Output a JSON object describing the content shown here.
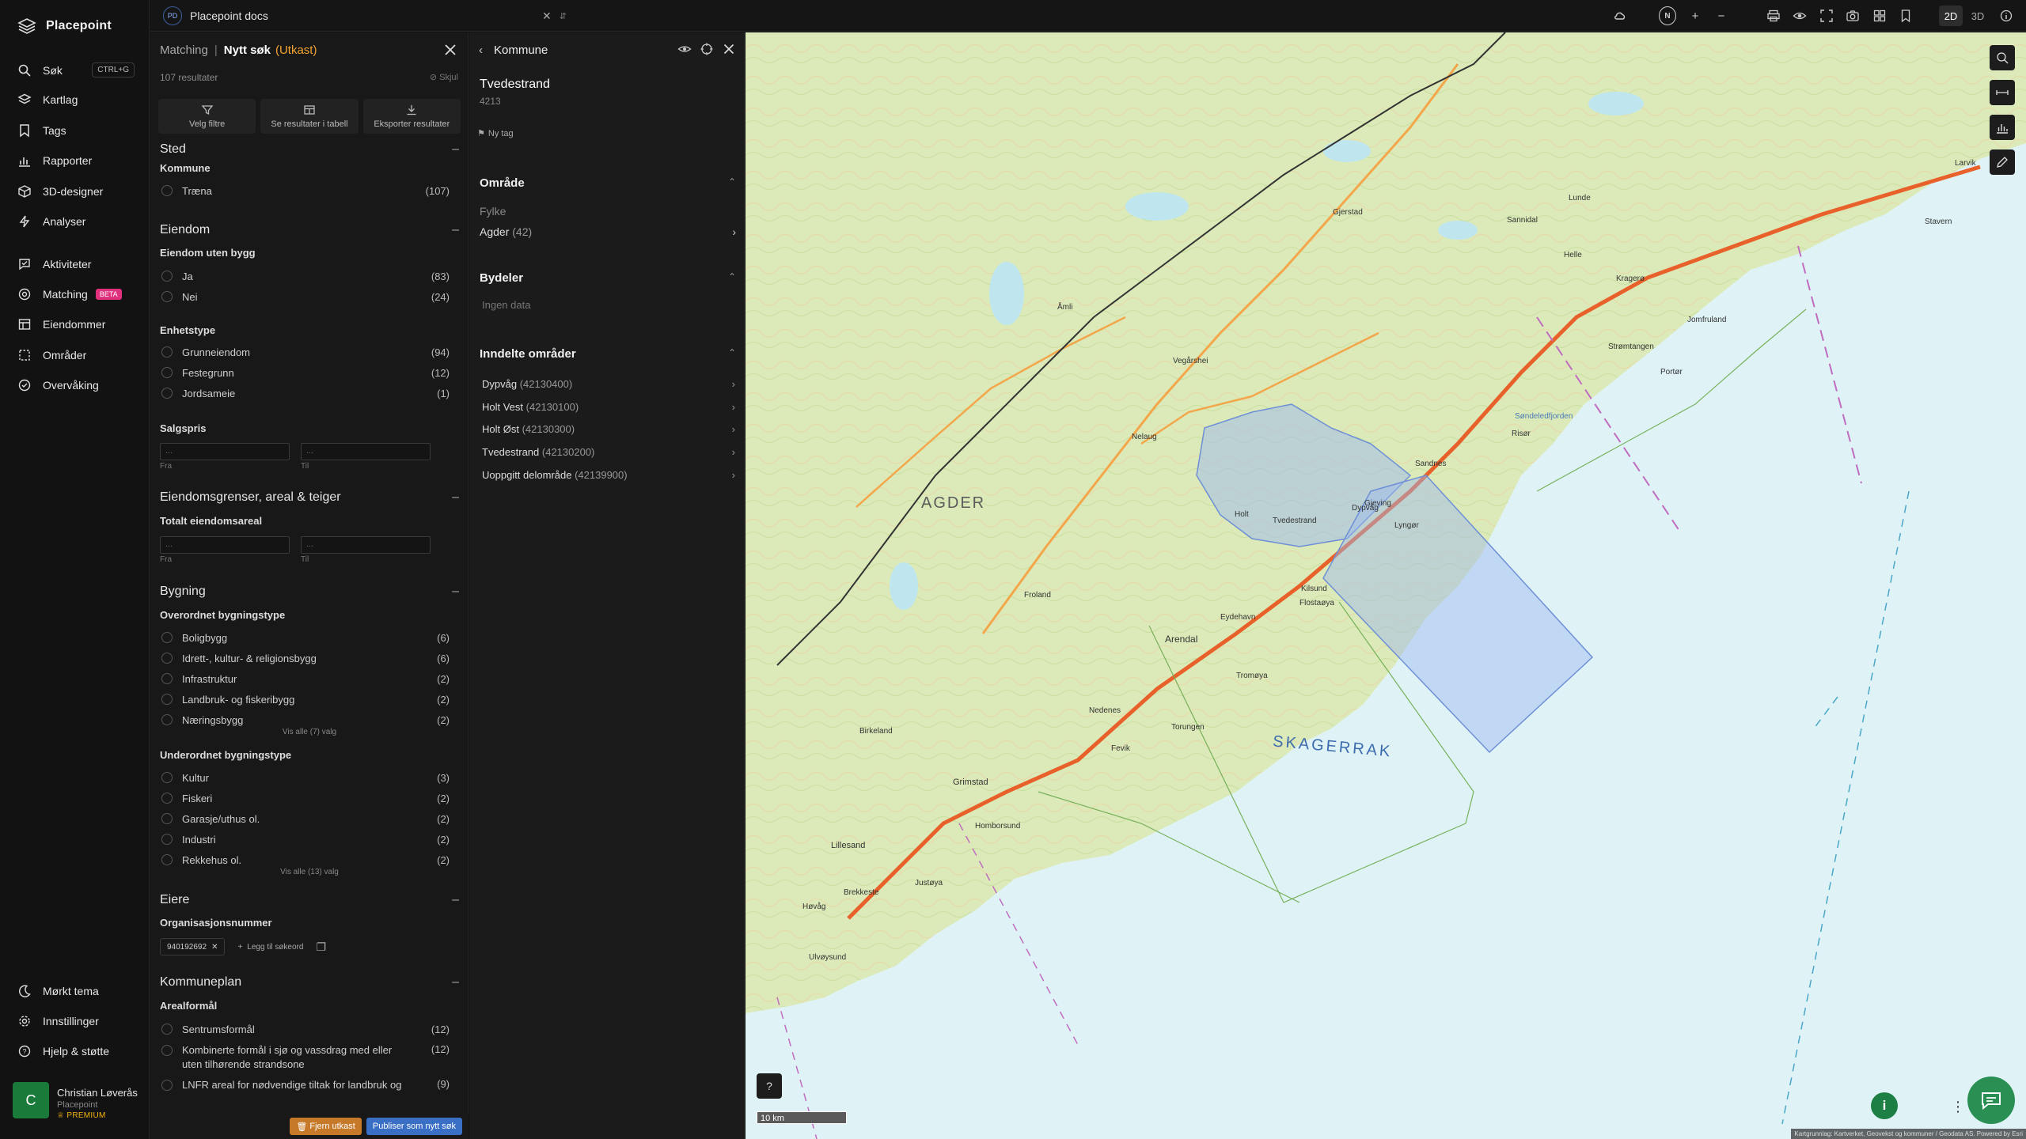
{
  "sidebar": {
    "brand": "Placepoint",
    "nav": [
      {
        "label": "Søk",
        "icon": "search-icon",
        "shortcut": "CTRL+G"
      },
      {
        "label": "Kartlag",
        "icon": "layers-icon"
      },
      {
        "label": "Tags",
        "icon": "bookmark-icon"
      },
      {
        "label": "Rapporter",
        "icon": "chart-icon"
      },
      {
        "label": "3D-designer",
        "icon": "cube-icon"
      },
      {
        "label": "Analyser",
        "icon": "bolt-icon"
      },
      {
        "label": "Aktiviteter",
        "icon": "activity-icon"
      },
      {
        "label": "Matching",
        "icon": "target-icon",
        "badge": "BETA"
      },
      {
        "label": "Eiendommer",
        "icon": "property-icon"
      },
      {
        "label": "Områder",
        "icon": "area-icon"
      },
      {
        "label": "Overvåking",
        "icon": "monitor-icon"
      }
    ],
    "bottom_nav": [
      {
        "label": "Mørkt tema",
        "icon": "moon-icon"
      },
      {
        "label": "Innstillinger",
        "icon": "gear-icon"
      },
      {
        "label": "Hjelp & støtte",
        "icon": "help-icon"
      }
    ],
    "user": {
      "initial": "C",
      "name": "Christian Løverås",
      "org": "Placepoint",
      "plan": "PREMIUM"
    }
  },
  "topbar": {
    "doc_badge": "PD",
    "doc_name": "Placepoint docs",
    "north": "N",
    "dim_2d": "2D",
    "dim_3d": "3D"
  },
  "filter": {
    "crumb": "Matching",
    "separator": "|",
    "title": "Nytt søk",
    "draft": "(Utkast)",
    "results": "107 resultater",
    "hide": "Skjul",
    "actions": [
      "Velg filtre",
      "Se resultater i tabell",
      "Eksporter resultater"
    ],
    "sections": {
      "sted": {
        "title": "Sted",
        "kommune_label": "Kommune",
        "options": [
          {
            "label": "Træna",
            "count": "(107)"
          }
        ]
      },
      "eiendom": {
        "title": "Eiendom",
        "uten_bygg_label": "Eiendom uten bygg",
        "uten_bygg": [
          {
            "label": "Ja",
            "count": "(83)"
          },
          {
            "label": "Nei",
            "count": "(24)"
          }
        ],
        "enhetstype_label": "Enhetstype",
        "enhetstype": [
          {
            "label": "Grunneiendom",
            "count": "(94)"
          },
          {
            "label": "Festegrunn",
            "count": "(12)"
          },
          {
            "label": "Jordsameie",
            "count": "(1)"
          }
        ],
        "salgspris_label": "Salgspris",
        "from_label": "Fra",
        "to_label": "Til",
        "placeholder": "..."
      },
      "grenser": {
        "title": "Eiendomsgrenser, areal & teiger",
        "total_label": "Totalt eiendomsareal"
      },
      "bygning": {
        "title": "Bygning",
        "overordnet_label": "Overordnet bygningstype",
        "overordnet": [
          {
            "label": "Boligbygg",
            "count": "(6)"
          },
          {
            "label": "Idrett-, kultur- & religionsbygg",
            "count": "(6)"
          },
          {
            "label": "Infrastruktur",
            "count": "(2)"
          },
          {
            "label": "Landbruk- og fiskeribygg",
            "count": "(2)"
          },
          {
            "label": "Næringsbygg",
            "count": "(2)"
          }
        ],
        "overordnet_more": "Vis alle (7) valg",
        "underordnet_label": "Underordnet bygningstype",
        "underordnet": [
          {
            "label": "Kultur",
            "count": "(3)"
          },
          {
            "label": "Fiskeri",
            "count": "(2)"
          },
          {
            "label": "Garasje/uthus ol.",
            "count": "(2)"
          },
          {
            "label": "Industri",
            "count": "(2)"
          },
          {
            "label": "Rekkehus ol.",
            "count": "(2)"
          }
        ],
        "underordnet_more": "Vis alle (13) valg"
      },
      "eiere": {
        "title": "Eiere",
        "org_label": "Organisasjonsnummer",
        "chip": "940192692",
        "add": "Legg til søkeord"
      },
      "kommuneplan": {
        "title": "Kommuneplan",
        "areal_label": "Arealformål",
        "options": [
          {
            "label": "Sentrumsformål",
            "count": "(12)"
          },
          {
            "label": "Kombinerte formål i sjø og vassdrag med eller uten tilhørende strandsone",
            "count": "(12)"
          },
          {
            "label": "LNFR areal for nødvendige tiltak for landbruk og reindrift og",
            "count": "(9)"
          }
        ]
      }
    },
    "footer": {
      "remove": "Fjern utkast",
      "publish": "Publiser som nytt søk"
    }
  },
  "kommune": {
    "header": "Kommune",
    "name": "Tvedestrand",
    "code": "4213",
    "tag": "Ny tag",
    "omrade": {
      "title": "Område",
      "fylke_label": "Fylke",
      "fylke": "Agder",
      "fylke_count": "(42)"
    },
    "bydeler": {
      "title": "Bydeler",
      "empty": "Ingen data"
    },
    "inndelte": {
      "title": "Inndelte områder",
      "items": [
        {
          "name": "Dypvåg",
          "code": "(42130400)"
        },
        {
          "name": "Holt Vest",
          "code": "(42130100)"
        },
        {
          "name": "Holt Øst",
          "code": "(42130300)"
        },
        {
          "name": "Tvedestrand",
          "code": "(42130200)"
        },
        {
          "name": "Uoppgitt delområde",
          "code": "(42139900)"
        }
      ]
    }
  },
  "map": {
    "region_label": "AGDER",
    "sea_label": "SKAGERRAK",
    "scale": "10 km",
    "attribution": "Kartgrunnlag: Kartverket, Geovekst og kommuner / Geodata AS. Powered by Esri",
    "places": [
      "Tvedestrand",
      "Arendal",
      "Grimstad",
      "Lillesand",
      "Risør",
      "Gjerstad",
      "Kragerø",
      "Froland",
      "Åmli",
      "Vegårshei",
      "Dypvåg",
      "Lyngør",
      "Tromøya",
      "Torungen",
      "Fevik",
      "Homborsund",
      "Kilsund",
      "Flostaøya",
      "Sandnes",
      "Holt",
      "Nelaug",
      "Birkeland",
      "Lunde",
      "Stavern",
      "Larvik",
      "Helle",
      "Sannidal",
      "Portør",
      "Jomfruland",
      "Strømtangen",
      "Gjeving",
      "Eydehavn",
      "Nedenes",
      "Ulvøysund",
      "Høvåg",
      "Brekkeste",
      "Justøya",
      "Søndeledfjorden"
    ],
    "colors": {
      "land": "#f4f0d8",
      "forest": "#d5e8b4",
      "water": "#cfeff6",
      "highway": "#e8612b",
      "road": "#f3a64a",
      "border": "#333333",
      "selection": "#9bb8f0"
    }
  }
}
